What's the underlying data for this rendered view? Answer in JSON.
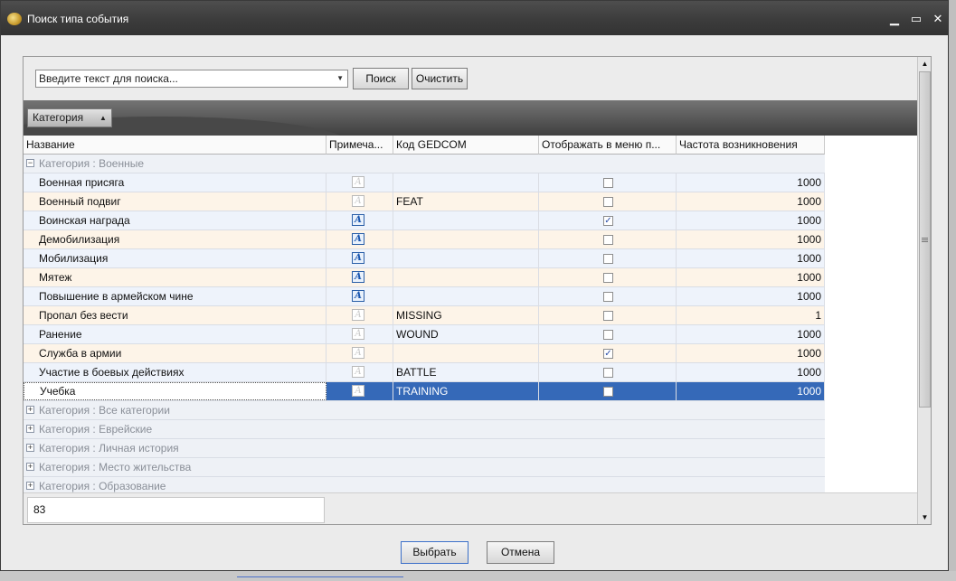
{
  "window": {
    "title": "Поиск типа события"
  },
  "search": {
    "placeholder": "Введите текст для поиска...",
    "search_label": "Поиск",
    "clear_label": "Очистить"
  },
  "grouping": {
    "tag_label": "Категория",
    "sort_glyph": "▲"
  },
  "columns": [
    "Название",
    "Примеча...",
    "Код GEDCOM",
    "Отображать в меню п...",
    "Частота возникновения"
  ],
  "open_group": "Категория : Военные",
  "rows": [
    {
      "name": "Военная присяга",
      "note": false,
      "code": "",
      "menu": false,
      "freq": "1000"
    },
    {
      "name": "Военный подвиг",
      "note": false,
      "code": "FEAT",
      "menu": false,
      "freq": "1000"
    },
    {
      "name": "Воинская награда",
      "note": true,
      "code": "",
      "menu": true,
      "freq": "1000"
    },
    {
      "name": "Демобилизация",
      "note": true,
      "code": "",
      "menu": false,
      "freq": "1000"
    },
    {
      "name": "Мобилизация",
      "note": true,
      "code": "",
      "menu": false,
      "freq": "1000"
    },
    {
      "name": "Мятеж",
      "note": true,
      "code": "",
      "menu": false,
      "freq": "1000"
    },
    {
      "name": "Повышение в армейском чине",
      "note": true,
      "code": "",
      "menu": false,
      "freq": "1000"
    },
    {
      "name": "Пропал без вести",
      "note": false,
      "code": "MISSING",
      "menu": false,
      "freq": "1"
    },
    {
      "name": "Ранение",
      "note": false,
      "code": "WOUND",
      "menu": false,
      "freq": "1000"
    },
    {
      "name": "Служба в армии",
      "note": false,
      "code": "",
      "menu": true,
      "freq": "1000"
    },
    {
      "name": "Участие в боевых действиях",
      "note": false,
      "code": "BATTLE",
      "menu": false,
      "freq": "1000"
    },
    {
      "name": "Учебка",
      "note": false,
      "code": "TRAINING",
      "menu": false,
      "freq": "1000",
      "selected": true
    }
  ],
  "closed_groups": [
    "Категория : Все категории",
    "Категория : Еврейские",
    "Категория : Личная история",
    "Категория : Место жительства",
    "Категория : Образование"
  ],
  "footer": {
    "count": "83"
  },
  "buttons": {
    "select_label": "Выбрать",
    "cancel_label": "Отмена"
  },
  "colors": {
    "selection": "#3569b8",
    "row_odd": "#eef3fb",
    "row_even": "#fdf4e8",
    "group_row": "#eef1f6"
  }
}
